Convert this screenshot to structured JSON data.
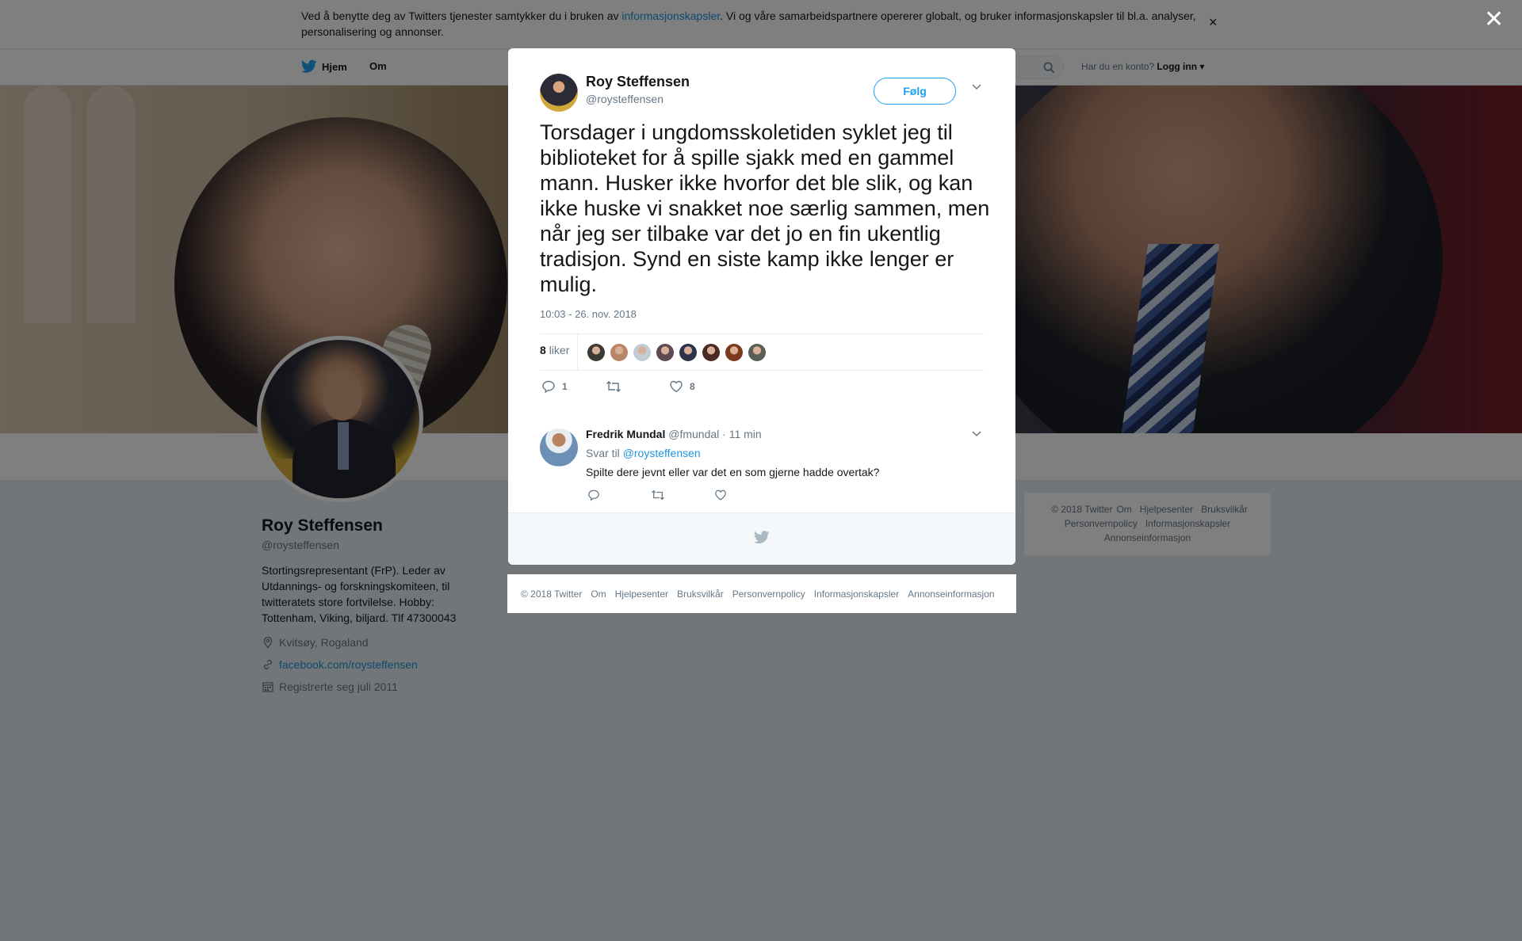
{
  "cookie_bar": {
    "text_before": "Ved å benytte deg av Twitters tjenester samtykker du i bruken av ",
    "link": "informasjonskapsler",
    "text_after": ". Vi og våre samarbeidspartnere opererer globalt, og bruker informasjonskapsler til bl.a. analyser, personalisering og annonser.",
    "close": "×"
  },
  "nav": {
    "home": "Hjem",
    "about": "Om",
    "search_placeholder": "",
    "login_question": "Har du en konto?",
    "login_link": "Logg inn"
  },
  "profile": {
    "name": "Roy Steffensen",
    "handle": "@roysteffensen",
    "bio": "Stortingsrepresentant (FrP). Leder av Utdannings- og forskningskomiteen, til twitteratets store fortvilelse. Hobby: Tottenham, Viking, biljard. Tlf 47300043",
    "location": "Kvitsøy, Rogaland",
    "url": "facebook.com/roysteffensen",
    "joined": "Registrerte seg juli 2011"
  },
  "side_footer": [
    "© 2018 Twitter",
    "Om",
    "Hjelpesenter",
    "Bruksvilkår",
    "Personvernpolicy",
    "Informasjonskapsler",
    "Annonseinformasjon"
  ],
  "overlay": {
    "close": "✕"
  },
  "tweet": {
    "author_name": "Roy Steffensen",
    "author_handle": "@roysteffensen",
    "follow_label": "Følg",
    "text": "Torsdager i ungdomsskoletiden syklet jeg til biblioteket for å spille sjakk med en gammel mann. Husker ikke hvorfor det ble slik, og kan ikke huske vi snakket noe særlig sammen, men når jeg ser tilbake var det jo en fin ukentlig tradisjon. Synd en siste kamp ikke lenger er mulig.",
    "timestamp": "10:03 - 26. nov. 2018",
    "likes_count": "8",
    "likes_label": "liker",
    "reply_count": "1",
    "retweet_count": "",
    "like_count": "8",
    "liker_colors": [
      "#3d3a36",
      "#b9856a",
      "#c2ccd6",
      "#5c4a52",
      "#2c3248",
      "#4a2a22",
      "#7a3a1e",
      "#5a5f55"
    ]
  },
  "reply": {
    "name": "Fredrik Mundal",
    "handle": "@fmundal",
    "time": "· 11 min",
    "reply_to_label": "Svar til",
    "reply_to_handle": "@roysteffensen",
    "text": "Spilte dere jevnt eller var det en som gjerne hadde overtak?"
  },
  "modal_footer": [
    "© 2018 Twitter",
    "Om",
    "Hjelpesenter",
    "Bruksvilkår",
    "Personvernpolicy",
    "Informasjonskapsler",
    "Annonseinformasjon"
  ]
}
